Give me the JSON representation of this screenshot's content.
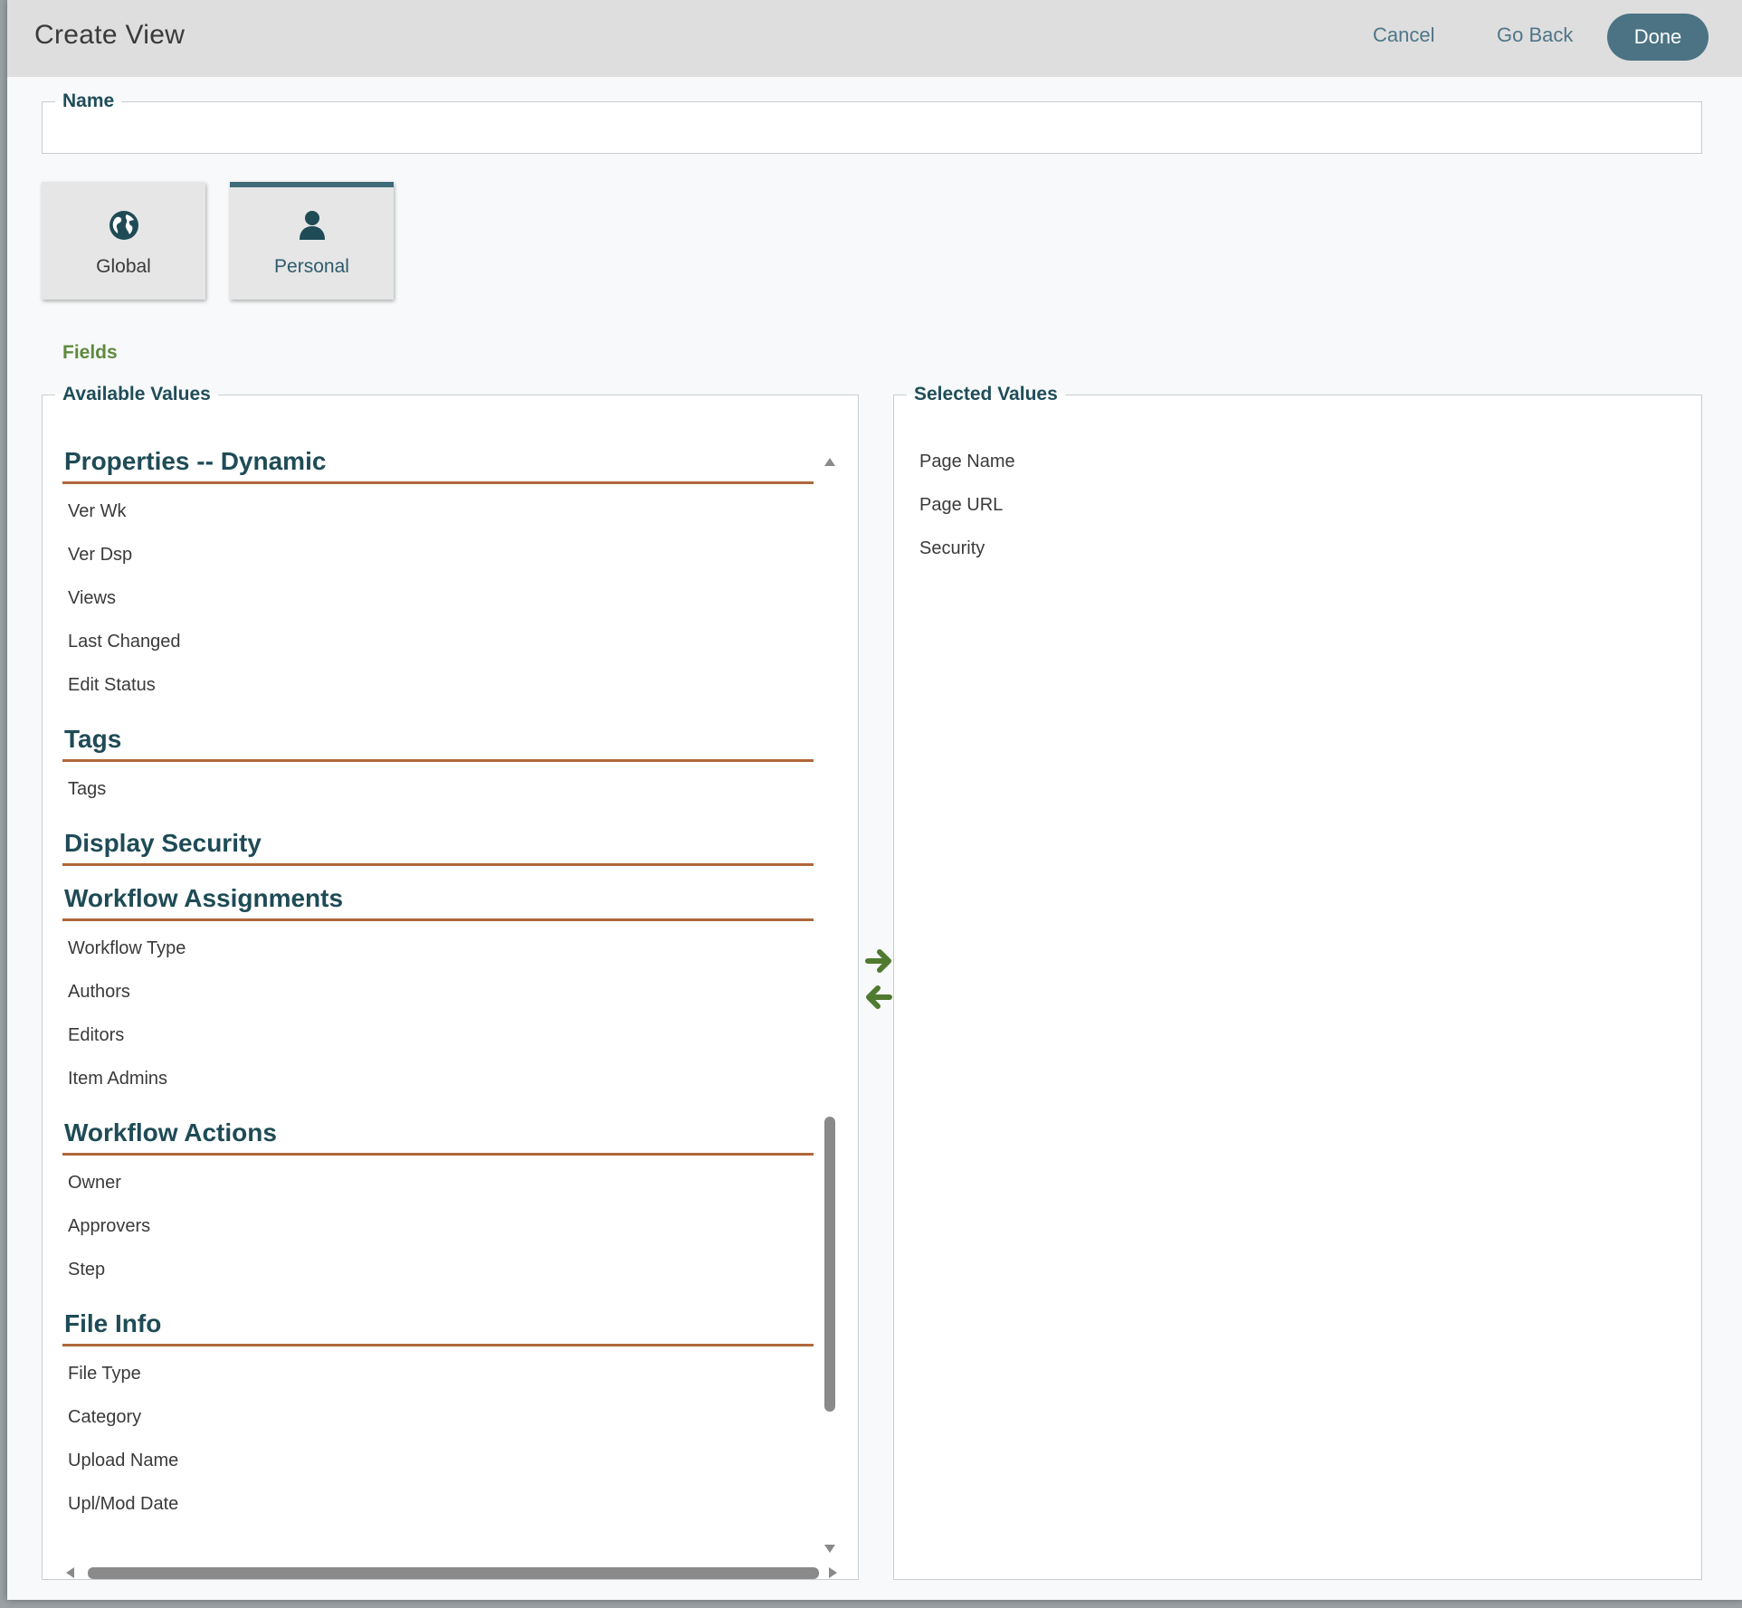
{
  "dialog": {
    "title": "Create View",
    "cancel_label": "Cancel",
    "goback_label": "Go Back",
    "done_label": "Done"
  },
  "name_field": {
    "legend": "Name",
    "value": ""
  },
  "scope": {
    "global_label": "Global",
    "personal_label": "Personal",
    "selected": "Personal"
  },
  "fields": {
    "label": "Fields",
    "available_legend": "Available Values",
    "selected_legend": "Selected Values",
    "groups": [
      {
        "title": "Properties -- Dynamic",
        "items": [
          "Ver Wk",
          "Ver Dsp",
          "Views",
          "Last Changed",
          "Edit Status"
        ]
      },
      {
        "title": "Tags",
        "items": [
          "Tags"
        ]
      },
      {
        "title": "Display Security",
        "items": []
      },
      {
        "title": "Workflow Assignments",
        "items": [
          "Workflow Type",
          "Authors",
          "Editors",
          "Item Admins"
        ]
      },
      {
        "title": "Workflow Actions",
        "items": [
          "Owner",
          "Approvers",
          "Step"
        ]
      },
      {
        "title": "File Info",
        "items": [
          "File Type",
          "Category",
          "Upload Name",
          "Upl/Mod Date"
        ]
      }
    ],
    "selected_items": [
      "Page Name",
      "Page URL",
      "Security"
    ]
  },
  "colors": {
    "accent": "#4b7383",
    "heading": "#1e4b56",
    "group_rule": "#b0673a",
    "fields_label": "#5e8a3e",
    "transfer_arrows": "#4f7a2f"
  },
  "icons": {
    "global": "globe-icon",
    "personal": "person-icon",
    "add": "arrow-right-icon",
    "remove": "arrow-left-icon"
  }
}
